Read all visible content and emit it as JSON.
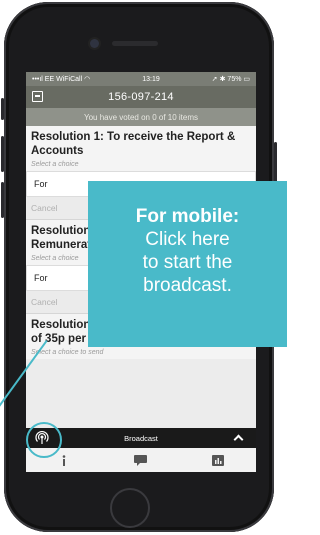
{
  "status": {
    "carrier": "EE WiFiCall",
    "time": "13:19",
    "battery": "75%"
  },
  "app": {
    "title": "156-097-214",
    "vote_status": "You have voted on 0 of 10 items"
  },
  "resolutions": [
    {
      "title": "Resolution 1: To receive the Report & Accounts",
      "hint": "Select a choice",
      "choice": "For",
      "cancel": "Cancel"
    },
    {
      "title": "Resolution 2: To approve the Directors' Remuneration",
      "hint": "Select a choice",
      "choice": "For",
      "cancel": "Cancel"
    },
    {
      "title": "Resolution 3: To declare a final dividend of 35p per share",
      "hint": "Select a choice to send",
      "choice": "",
      "cancel": ""
    }
  ],
  "broadcast": {
    "label": "Broadcast",
    "icon": "broadcast-icon"
  },
  "tabs": [
    {
      "icon": "info-icon"
    },
    {
      "icon": "chat-icon"
    },
    {
      "icon": "chart-icon"
    }
  ],
  "callout": {
    "heading": "For mobile:",
    "line1": "Click here",
    "line2": "to start the",
    "line3": "broadcast."
  },
  "colors": {
    "accent": "#49bac9",
    "app_bar": "#686b62",
    "broadcast_bar": "#1a1a1a"
  }
}
